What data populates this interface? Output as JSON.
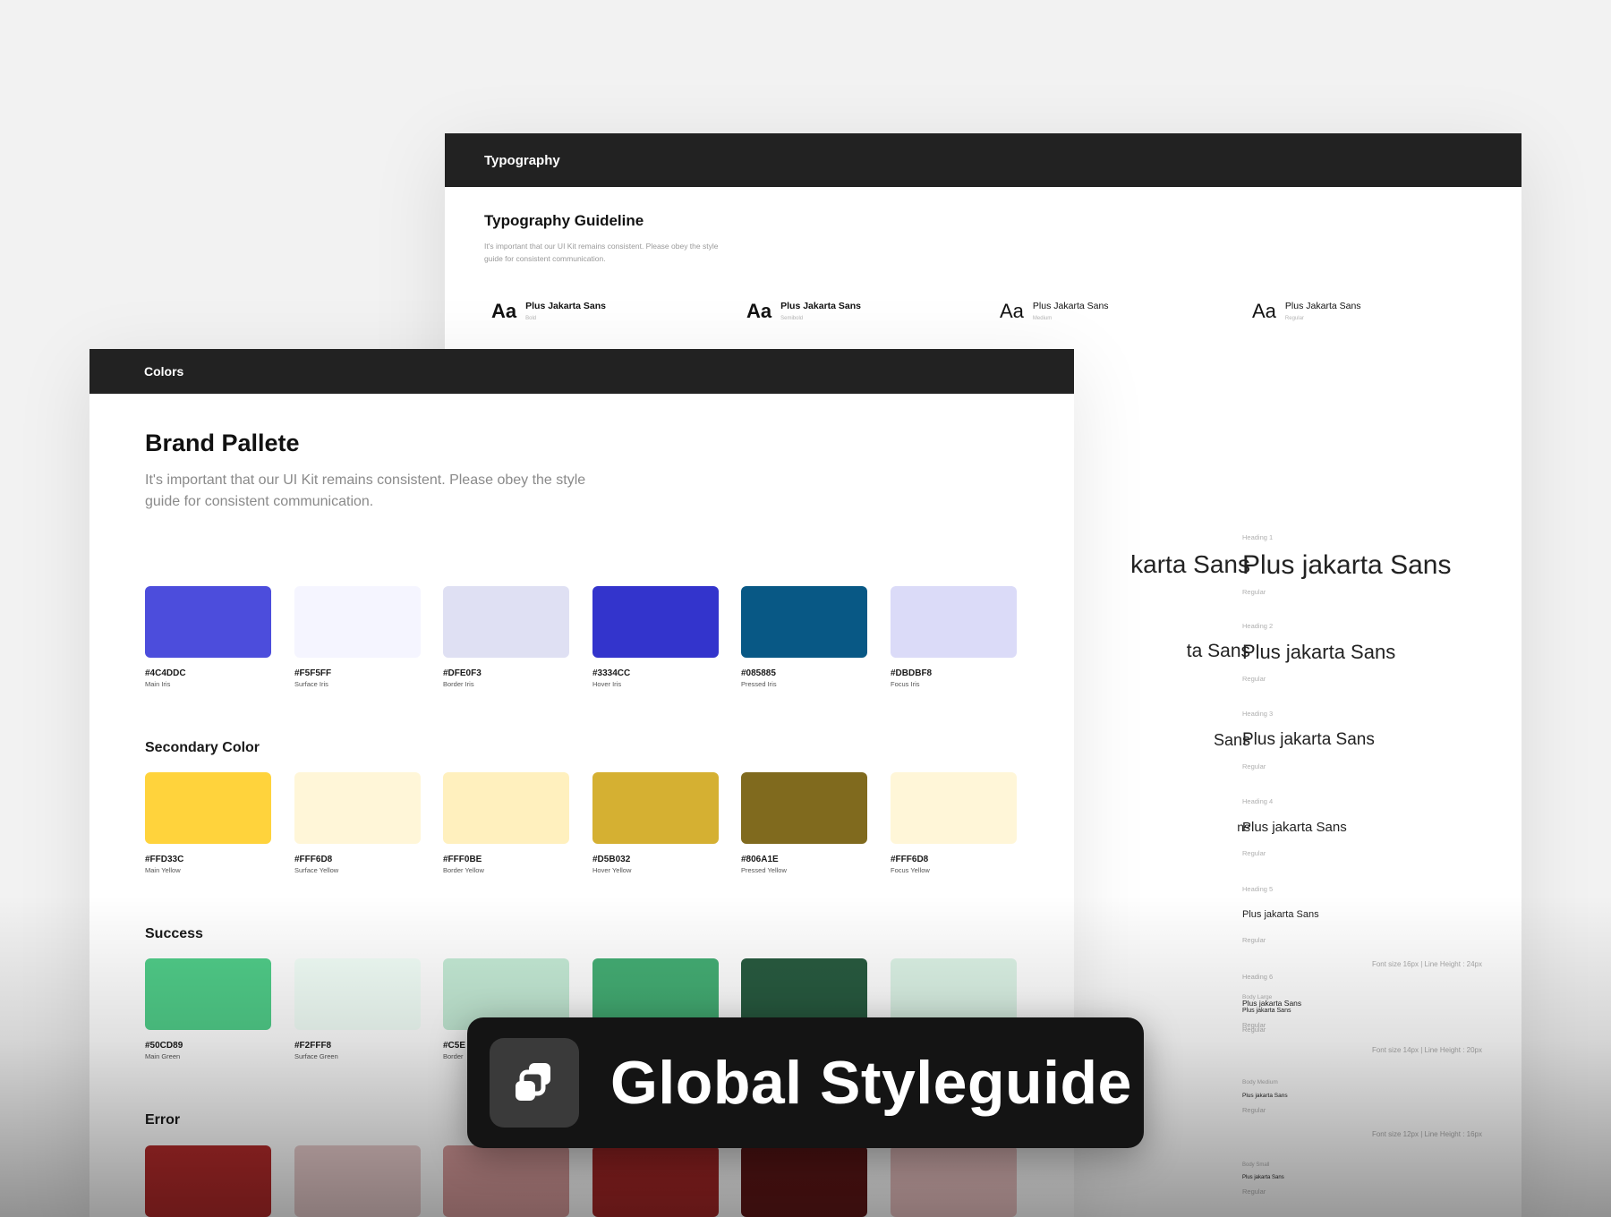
{
  "typography_panel": {
    "header": "Typography",
    "title": "Typography Guideline",
    "description": "It's important that our UI Kit remains consistent. Please obey the style guide for consistent communication.",
    "weights": [
      {
        "aa": "Aa",
        "name": "Plus Jakarta Sans",
        "weight": "Bold"
      },
      {
        "aa": "Aa",
        "name": "Plus Jakarta Sans",
        "weight": "Semibold"
      },
      {
        "aa": "Aa",
        "name": "Plus Jakarta Sans",
        "weight": "Medium"
      },
      {
        "aa": "Aa",
        "name": "Plus Jakarta Sans",
        "weight": "Regular"
      }
    ],
    "headings": [
      {
        "label": "Heading 1",
        "sample": "Plus jakarta Sans",
        "style": "Regular"
      },
      {
        "label": "Heading 2",
        "sample": "Plus jakarta Sans",
        "style": "Regular"
      },
      {
        "label": "Heading 3",
        "sample": "Plus jakarta Sans",
        "style": "Regular"
      },
      {
        "label": "Heading 4",
        "sample": "Plus jakarta Sans",
        "style": "Regular"
      },
      {
        "label": "Heading 5",
        "sample": "Plus jakarta Sans",
        "style": "Regular"
      },
      {
        "label": "Heading 6",
        "sample": "Plus jakarta Sans",
        "style": "Regular"
      }
    ],
    "partial_headings": [
      "karta Sans",
      "ta Sans",
      "Sans",
      "ns"
    ],
    "body": [
      {
        "note": "Font size 16px | Line Height : 24px",
        "label": "Body Large",
        "sample": "Plus jakarta Sans",
        "style": "Regular"
      },
      {
        "note": "Font size 14px | Line Height : 20px",
        "label": "Body Medium",
        "sample": "Plus jakarta Sans",
        "style": "Regular"
      },
      {
        "note": "Font size 12px | Line Height : 16px",
        "label": "Body Small",
        "sample": "Plus jakarta Sans",
        "style": "Regular"
      }
    ]
  },
  "colors_panel": {
    "header": "Colors",
    "title": "Brand Pallete",
    "description": "It's important that our UI Kit remains consistent. Please obey the style guide for consistent communication.",
    "groups": [
      {
        "title": "",
        "swatches": [
          {
            "hex": "#4C4DDC",
            "name": "Main Iris",
            "color": "#4C4DDC"
          },
          {
            "hex": "#F5F5FF",
            "name": "Surface Iris",
            "color": "#F5F5FF"
          },
          {
            "hex": "#DFE0F3",
            "name": "Border Iris",
            "color": "#DFE0F3"
          },
          {
            "hex": "#3334CC",
            "name": "Hover Iris",
            "color": "#3334CC"
          },
          {
            "hex": "#085885",
            "name": "Pressed Iris",
            "color": "#085885"
          },
          {
            "hex": "#DBDBF8",
            "name": "Focus Iris",
            "color": "#DBDBF8"
          }
        ]
      },
      {
        "title": "Secondary Color",
        "swatches": [
          {
            "hex": "#FFD33C",
            "name": "Main Yellow",
            "color": "#FFD33C"
          },
          {
            "hex": "#FFF6D8",
            "name": "Surface Yellow",
            "color": "#FFF6D8"
          },
          {
            "hex": "#FFF0BE",
            "name": "Border Yellow",
            "color": "#FFF0BE"
          },
          {
            "hex": "#D5B032",
            "name": "Hover Yellow",
            "color": "#D5B032"
          },
          {
            "hex": "#806A1E",
            "name": "Pressed Yellow",
            "color": "#806A1E"
          },
          {
            "hex": "#FFF6D8",
            "name": "Focus Yellow",
            "color": "#FFF6D8"
          }
        ]
      },
      {
        "title": "Success",
        "swatches": [
          {
            "hex": "#50CD89",
            "name": "Main Green",
            "color": "#50CD89"
          },
          {
            "hex": "#F2FFF8",
            "name": "Surface Green",
            "color": "#F2FFF8"
          },
          {
            "hex": "#C5E",
            "name": "Border",
            "color": "#C5EBD6"
          },
          {
            "hex": "",
            "name": "",
            "color": "#44AE74"
          },
          {
            "hex": "",
            "name": "",
            "color": "#285B40"
          },
          {
            "hex": "",
            "name": "",
            "color": "#DCF3E6"
          }
        ]
      },
      {
        "title": "Error",
        "swatches": [
          {
            "hex": "",
            "name": "",
            "color": "#B22A2A"
          },
          {
            "hex": "",
            "name": "",
            "color": "#E6CACA"
          },
          {
            "hex": "",
            "name": "",
            "color": "#D69A9A"
          },
          {
            "hex": "",
            "name": "",
            "color": "#A32626"
          },
          {
            "hex": "",
            "name": "",
            "color": "#5E1616"
          },
          {
            "hex": "",
            "name": "",
            "color": "#E8C0C0"
          }
        ]
      }
    ]
  },
  "badge": {
    "text": "Global Styleguide",
    "icon": "copy-layers-icon"
  }
}
